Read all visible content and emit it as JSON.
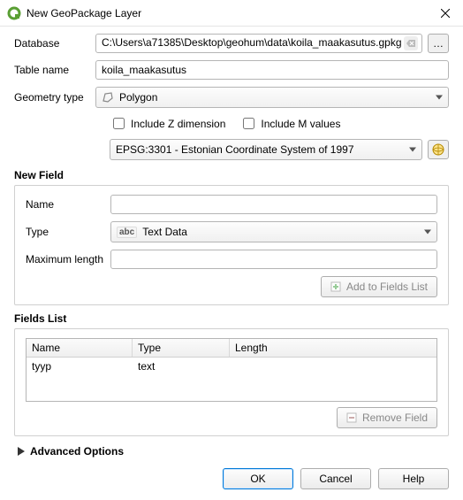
{
  "window": {
    "title": "New GeoPackage Layer"
  },
  "labels": {
    "database": "Database",
    "table_name": "Table name",
    "geometry_type": "Geometry type",
    "include_z": "Include Z dimension",
    "include_m": "Include M values",
    "new_field": "New Field",
    "name": "Name",
    "type": "Type",
    "max_length": "Maximum length",
    "add_to_fields": "Add to Fields List",
    "fields_list": "Fields List",
    "col_name": "Name",
    "col_type": "Type",
    "col_length": "Length",
    "remove_field": "Remove Field",
    "advanced": "Advanced Options",
    "ok": "OK",
    "cancel": "Cancel",
    "help": "Help",
    "browse": "…"
  },
  "values": {
    "database_path": "C:\\Users\\a71385\\Desktop\\geohum\\data\\koila_maakasutus.gpkg",
    "table_name": "koila_maakasutus",
    "geometry_type": "Polygon",
    "field_type": "Text Data",
    "crs": "EPSG:3301 - Estonian Coordinate System of 1997",
    "new_field_name": "",
    "new_field_maxlen": ""
  },
  "fields": [
    {
      "name": "tyyp",
      "type": "text",
      "length": ""
    }
  ]
}
